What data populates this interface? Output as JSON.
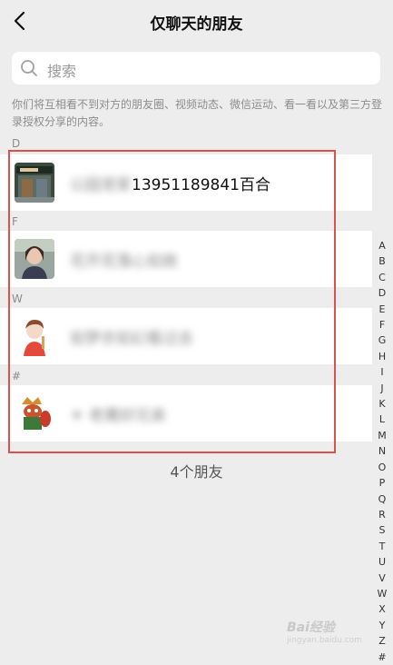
{
  "header": {
    "title": "仅聊天的朋友",
    "back_icon": "chevron-left-icon"
  },
  "search": {
    "placeholder": "搜索",
    "icon": "search-icon"
  },
  "description": "你们将互相看不到对方的朋友圈、视频动态、微信运动、看一看以及第三方登录授权分享的内容。",
  "sections": [
    {
      "letter": "D",
      "contact_visible": "13951189841百合"
    },
    {
      "letter": "F"
    },
    {
      "letter": "W"
    },
    {
      "letter": "#"
    }
  ],
  "footer": {
    "count_text": "4个朋友"
  },
  "index_letters": [
    "A",
    "B",
    "C",
    "D",
    "E",
    "F",
    "G",
    "H",
    "I",
    "J",
    "K",
    "L",
    "M",
    "N",
    "O",
    "P",
    "Q",
    "R",
    "S",
    "T",
    "U",
    "V",
    "W",
    "X",
    "Y",
    "Z",
    "#"
  ],
  "watermark": {
    "text": "Bai经验",
    "sub": "jingyan.baidu.com"
  },
  "colors": {
    "background": "#ededed",
    "highlight_border": "#d9534f"
  }
}
